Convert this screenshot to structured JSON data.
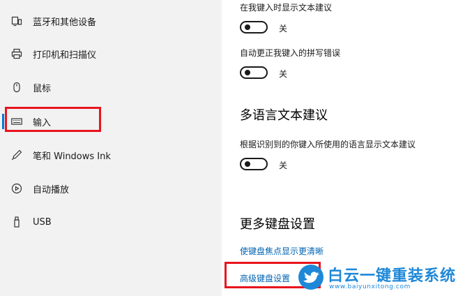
{
  "sidebar": {
    "items": [
      {
        "label": "蓝牙和其他设备",
        "icon": "bluetooth-devices-icon"
      },
      {
        "label": "打印机和扫描仪",
        "icon": "printer-icon"
      },
      {
        "label": "鼠标",
        "icon": "mouse-icon"
      },
      {
        "label": "输入",
        "icon": "keyboard-icon",
        "selected": true
      },
      {
        "label": "笔和 Windows Ink",
        "icon": "pen-icon"
      },
      {
        "label": "自动播放",
        "icon": "autoplay-icon"
      },
      {
        "label": "USB",
        "icon": "usb-icon"
      }
    ]
  },
  "main": {
    "setting1": {
      "label": "在我键入时显示文本建议",
      "state": "关",
      "on": false
    },
    "setting2": {
      "label": "自动更正我键入的拼写错误",
      "state": "关",
      "on": false
    },
    "section_multilang": {
      "title": "多语言文本建议"
    },
    "setting3": {
      "label": "根据识别到的你键入所使用的语言显示文本建议",
      "state": "关",
      "on": false
    },
    "section_more": {
      "title": "更多键盘设置"
    },
    "link_focus": "使键盘焦点显示更清晰",
    "link_advanced": "高级键盘设置"
  },
  "watermark": {
    "brand": "白云一键重装系统",
    "url": "www.baiyunxitong.com"
  },
  "colors": {
    "accent": "#0078d7",
    "link": "#0063b1",
    "highlight_box": "#e8141e",
    "watermark": "#1e88d8",
    "sidebar_bg": "#f2f2f2"
  }
}
